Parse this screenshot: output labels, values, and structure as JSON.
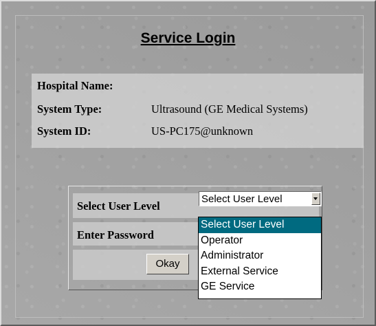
{
  "title": "Service Login",
  "info": {
    "hospital_label": "Hospital Name:",
    "hospital_value": "",
    "system_type_label": "System Type:",
    "system_type_value": "Ultrasound (GE Medical Systems)",
    "system_id_label": "System ID:",
    "system_id_value": "US-PC175@unknown"
  },
  "login": {
    "user_level_label": "Select User Level",
    "user_level_selected": "Select User Level",
    "password_label": "Enter Password",
    "okay_label": "Okay"
  },
  "dropdown": {
    "options": [
      "Select User Level",
      "Operator",
      "Administrator",
      "External Service",
      "GE Service"
    ],
    "selected_index": 0
  },
  "colors": {
    "selection_highlight": "#006a80",
    "panel_background": "#a3a3a3"
  }
}
